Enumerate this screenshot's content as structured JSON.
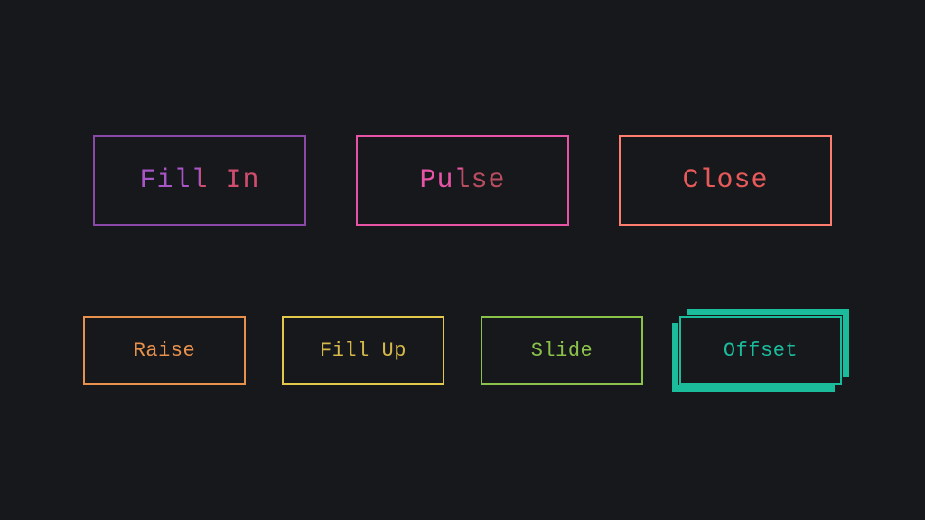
{
  "buttons": {
    "row1": [
      {
        "label": "Fill In",
        "color": "#8a49a8"
      },
      {
        "label": "Pulse",
        "color": "#e754a6"
      },
      {
        "label": "Close",
        "color": "#ff7d6e"
      }
    ],
    "row2": [
      {
        "label": "Raise",
        "color": "#e8914c"
      },
      {
        "label": "Fill Up",
        "color": "#e2c94c"
      },
      {
        "label": "Slide",
        "color": "#8bc34a"
      },
      {
        "label": "Offset",
        "color": "#1abc9c"
      }
    ]
  },
  "colors": {
    "background": "#17181c",
    "purple": "#8a49a8",
    "pink": "#e754a6",
    "salmon": "#ff7d6e",
    "orange": "#e8914c",
    "yellow": "#e2c94c",
    "green": "#8bc34a",
    "teal": "#1abc9c"
  }
}
